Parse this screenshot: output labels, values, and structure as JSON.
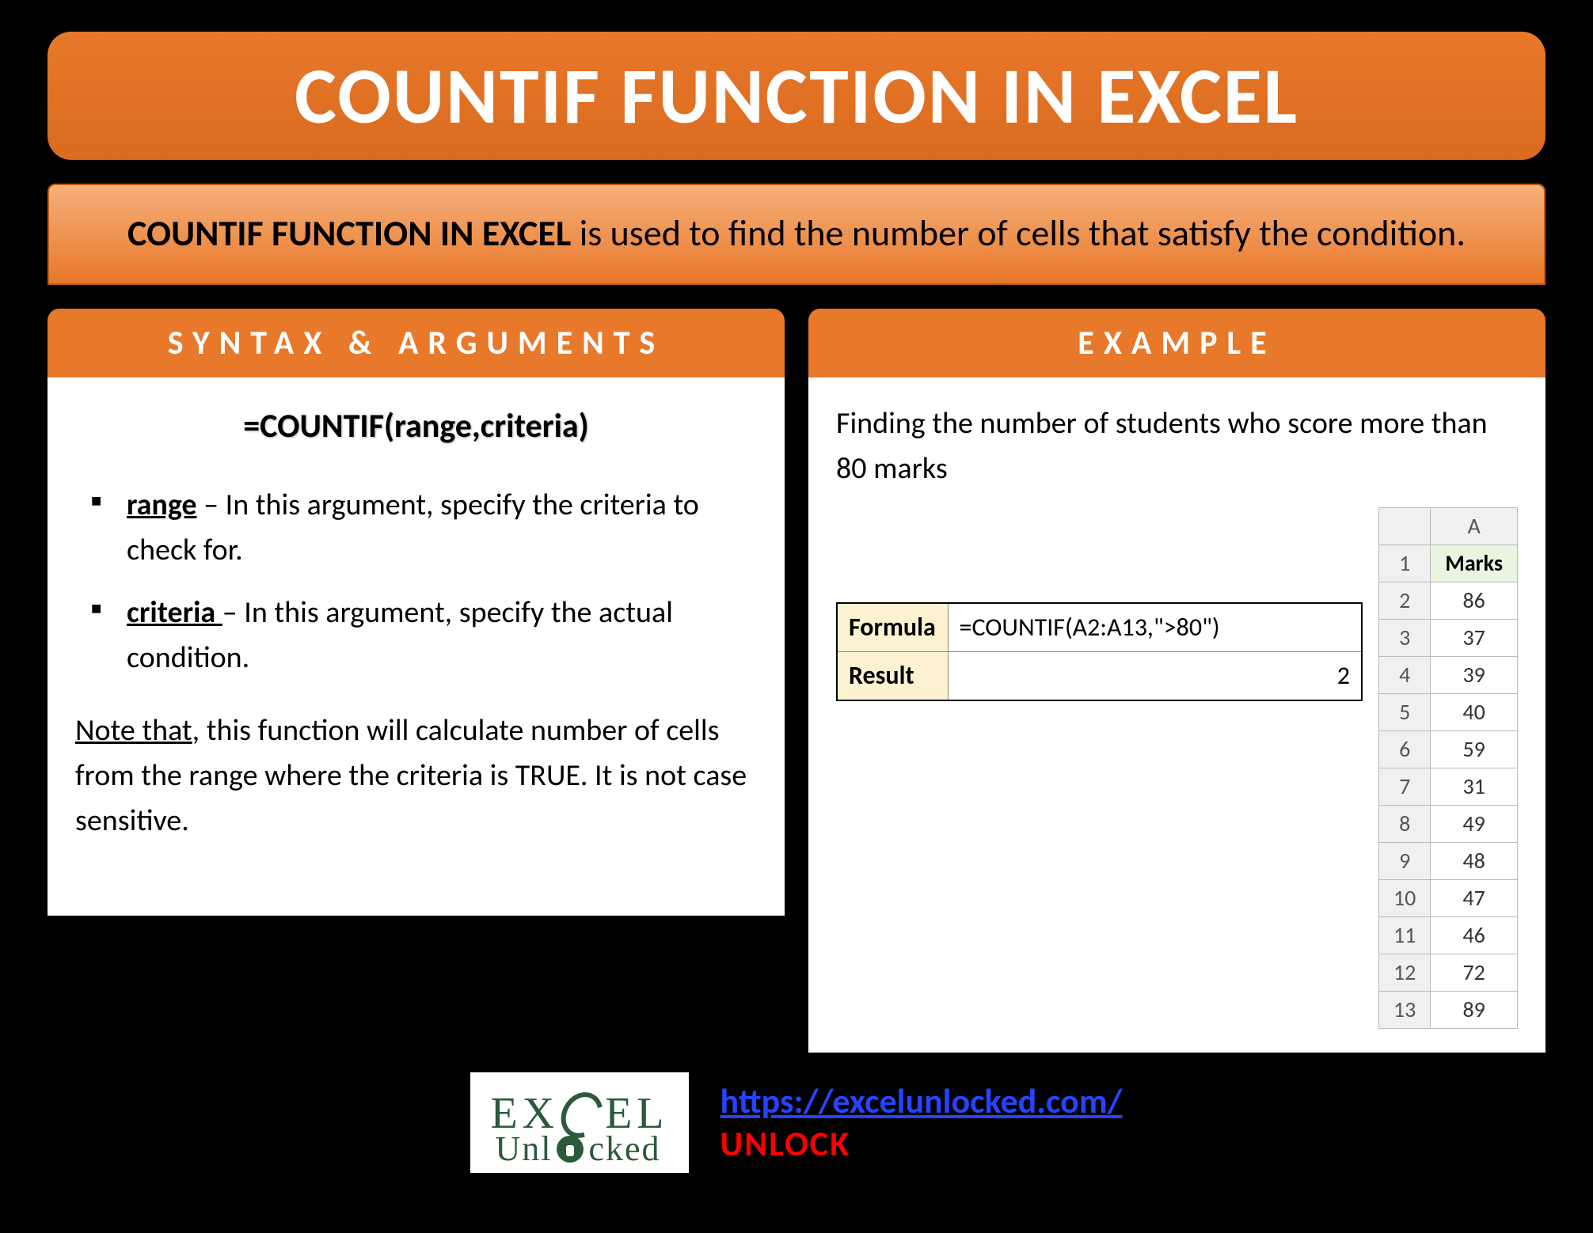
{
  "title": "COUNTIF FUNCTION IN EXCEL",
  "description": {
    "bold": "COUNTIF FUNCTION IN EXCEL",
    "rest": " is used to find the number of cells that satisfy the condition."
  },
  "left": {
    "header": "SYNTAX & ARGUMENTS",
    "syntax": "=COUNTIF(range,criteria)",
    "args": [
      {
        "term": "range",
        "text": " – In this argument, specify the criteria to check for."
      },
      {
        "term": "criteria ",
        "text": "– In this argument, specify the actual condition."
      }
    ],
    "note_ul": "Note that",
    "note_rest": ", this function will calculate number of cells from the range where the criteria is TRUE. It is not case sensitive."
  },
  "right": {
    "header": "EXAMPLE",
    "text": "Finding the number of students who score more than 80 marks",
    "formula_label": "Formula",
    "formula_value": "=COUNTIF(A2:A13,\">80\")",
    "result_label": "Result",
    "result_value": "2",
    "marks_col": "A",
    "marks_header": "Marks",
    "marks": [
      "86",
      "37",
      "39",
      "40",
      "59",
      "31",
      "49",
      "48",
      "47",
      "46",
      "72",
      "89"
    ],
    "row_nums": [
      "1",
      "2",
      "3",
      "4",
      "5",
      "6",
      "7",
      "8",
      "9",
      "10",
      "11",
      "12",
      "13"
    ]
  },
  "footer": {
    "logo_l1a": "EX",
    "logo_l1b": "EL",
    "logo_l2a": "Unl",
    "logo_l2b": "cked",
    "url": "https://excelunlocked.com/",
    "unlock": "UNLOCK"
  }
}
